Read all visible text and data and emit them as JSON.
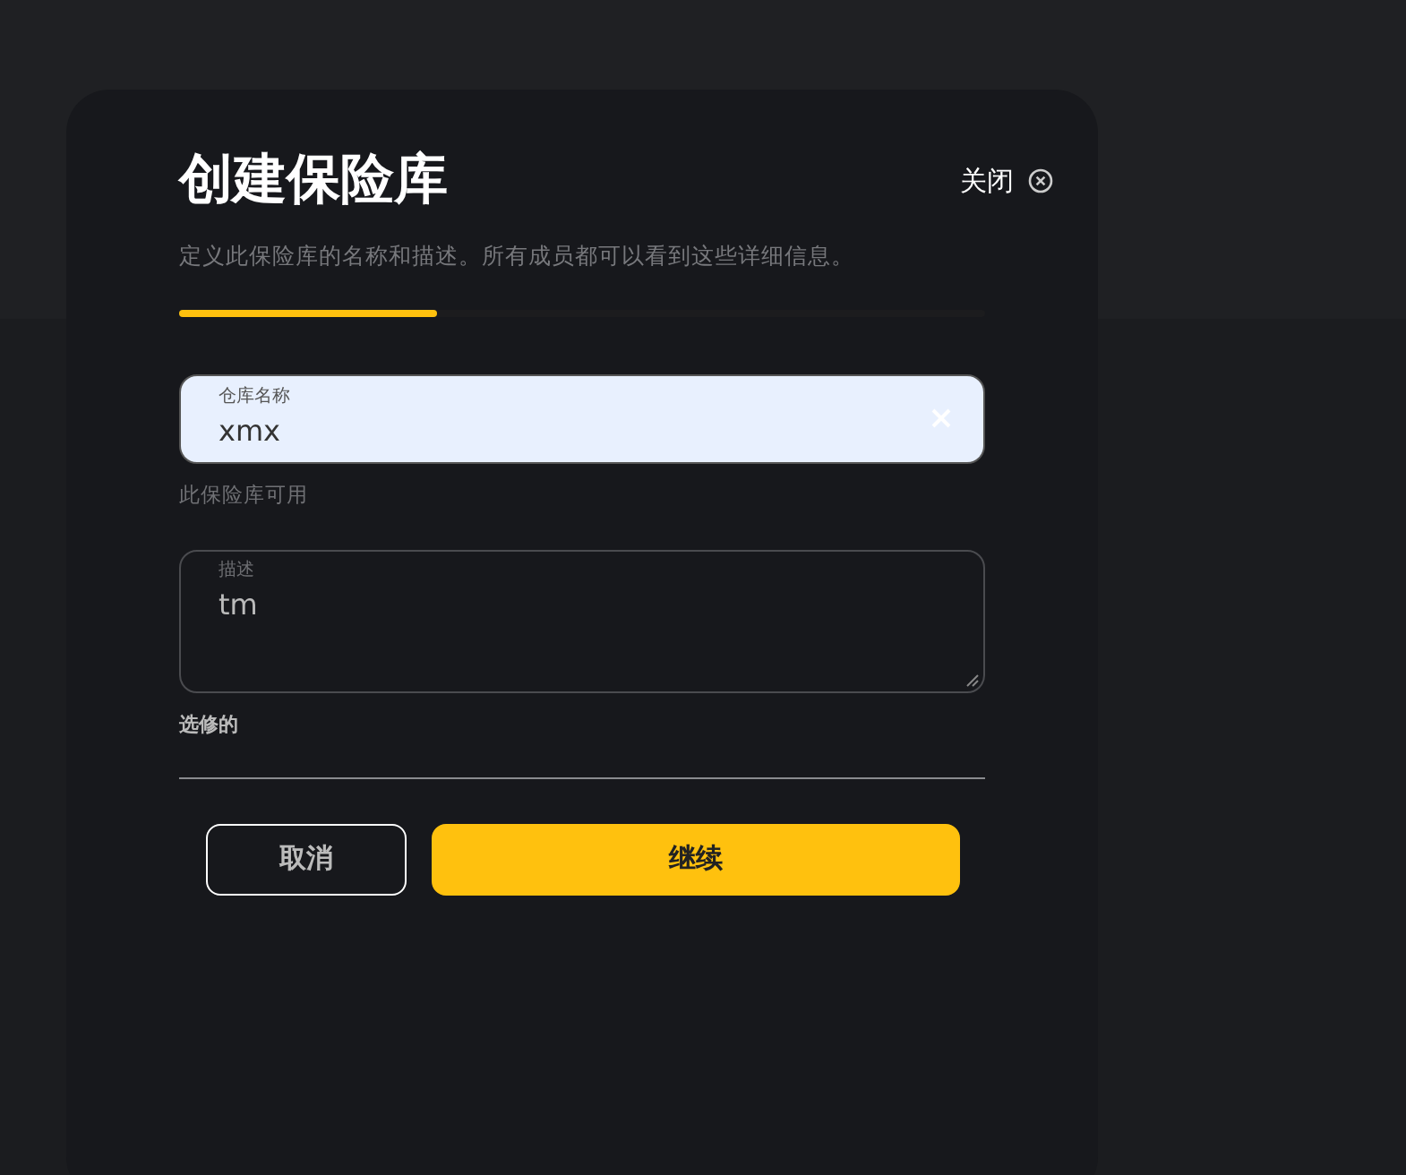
{
  "dialog": {
    "title": "创建保险库",
    "close_label": "关闭",
    "description": "定义此保险库的名称和描述。所有成员都可以看到这些详细信息。",
    "progress": {
      "level": 0.32
    },
    "name_field": {
      "label": "仓库名称",
      "value": "xmx",
      "hint": "此保险库可用"
    },
    "description_field": {
      "label": "描述",
      "value": "tm",
      "hint": "选修的"
    },
    "buttons": [
      {
        "label": "取消",
        "kind": "secondary"
      },
      {
        "label": "继续",
        "kind": "primary"
      }
    ]
  }
}
